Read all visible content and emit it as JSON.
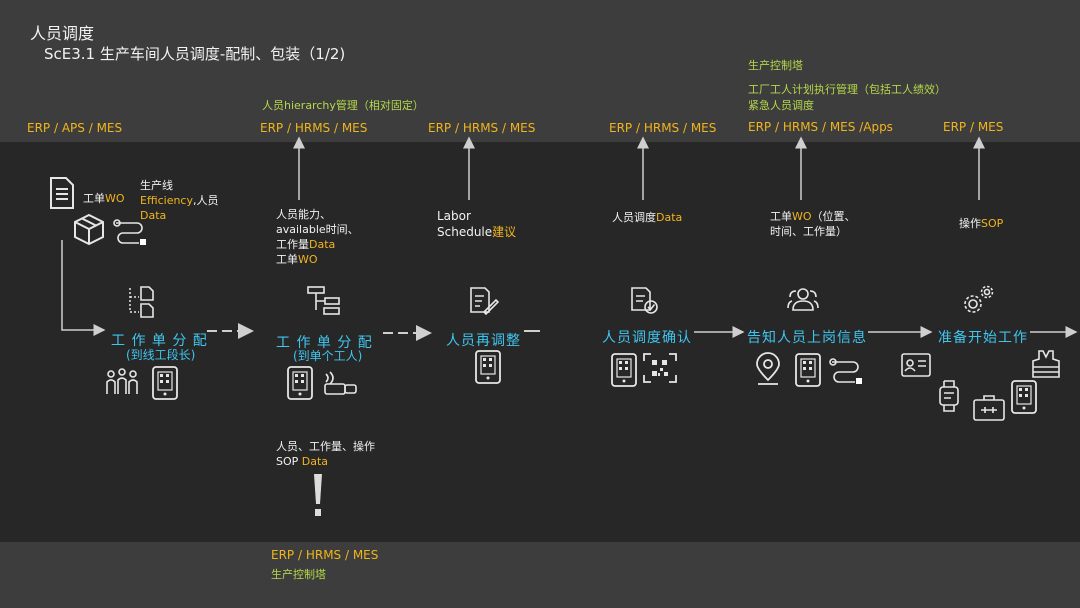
{
  "header": {
    "title": "人员调度",
    "subtitle": "ScE3.1 生产车间人员调度-配制、包装（1/2)"
  },
  "systems": [
    "ERP  / APS / MES",
    "ERP / HRMS / MES",
    "ERP / HRMS / MES",
    "ERP / HRMS / MES",
    "ERP / HRMS / MES /Apps",
    "ERP / MES"
  ],
  "green_notes": {
    "hierarchy": "人员hierarchy管理（相对固定）",
    "control_tower_top": "生产控制塔",
    "plan_exec": "工厂工人计划执行管理（包括工人绩效）",
    "emergency": "紧急人员调度",
    "bottom_systems": "ERP / HRMS / MES",
    "control_tower_bottom": "生产控制塔"
  },
  "inputs": {
    "wo_label_a": "工单",
    "wo_label_b": "WO",
    "line_a": "生产线",
    "line_b": "Efficiency",
    "line_c": ",人员",
    "line_d": "Data",
    "ability_1": "人员能力、",
    "ability_2": "available时间、",
    "ability_3a": "工作量",
    "ability_3b": "Data",
    "ability_4a": "工单",
    "ability_4b": "WO",
    "labor_1": "Labor",
    "labor_2a": "Schedule",
    "labor_2b": "建议",
    "confirm_a": "人员调度",
    "confirm_b": "Data",
    "notify_1a": "工单",
    "notify_1b": "WO",
    "notify_1c": "（位置、",
    "notify_2": "时间、工作量）",
    "sop_a": "操作",
    "sop_b": "SOP",
    "bottom_1": "人员、工作量、操作",
    "bottom_2a": "SOP ",
    "bottom_2b": "Data"
  },
  "steps": {
    "s1": "工 作 单 分 配",
    "s1_sub": "(到线工段长)",
    "s2": "工 作 单 分 配",
    "s2_sub": "(到单个工人)",
    "s3": "人员再调整",
    "s4": "人员调度确认",
    "s5": "告知人员上岗信息",
    "s6": "准备开始工作"
  },
  "colors": {
    "background_top": "#3d3d3d",
    "background_mid": "#272727",
    "yellow": "#f1b51c",
    "green": "#b5d84a",
    "cyan": "#3fc6ef",
    "white": "#f2f2f2"
  }
}
